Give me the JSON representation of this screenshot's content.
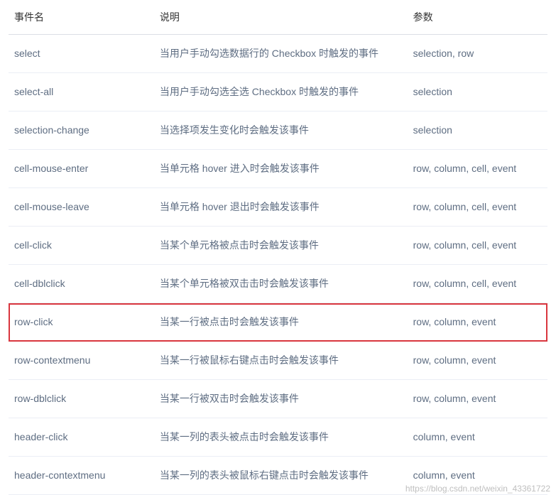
{
  "headers": {
    "name": "事件名",
    "desc": "说明",
    "params": "参数"
  },
  "rows": [
    {
      "name": "select",
      "desc": "当用户手动勾选数据行的 Checkbox 时触发的事件",
      "params": "selection, row",
      "highlighted": false
    },
    {
      "name": "select-all",
      "desc": "当用户手动勾选全选 Checkbox 时触发的事件",
      "params": "selection",
      "highlighted": false
    },
    {
      "name": "selection-change",
      "desc": "当选择项发生变化时会触发该事件",
      "params": "selection",
      "highlighted": false
    },
    {
      "name": "cell-mouse-enter",
      "desc": "当单元格 hover 进入时会触发该事件",
      "params": "row, column, cell, event",
      "highlighted": false
    },
    {
      "name": "cell-mouse-leave",
      "desc": "当单元格 hover 退出时会触发该事件",
      "params": "row, column, cell, event",
      "highlighted": false
    },
    {
      "name": "cell-click",
      "desc": "当某个单元格被点击时会触发该事件",
      "params": "row, column, cell, event",
      "highlighted": false
    },
    {
      "name": "cell-dblclick",
      "desc": "当某个单元格被双击击时会触发该事件",
      "params": "row, column, cell, event",
      "highlighted": false
    },
    {
      "name": "row-click",
      "desc": "当某一行被点击时会触发该事件",
      "params": "row, column, event",
      "highlighted": true
    },
    {
      "name": "row-contextmenu",
      "desc": "当某一行被鼠标右键点击时会触发该事件",
      "params": "row, column, event",
      "highlighted": false
    },
    {
      "name": "row-dblclick",
      "desc": "当某一行被双击时会触发该事件",
      "params": "row, column, event",
      "highlighted": false
    },
    {
      "name": "header-click",
      "desc": "当某一列的表头被点击时会触发该事件",
      "params": "column, event",
      "highlighted": false
    },
    {
      "name": "header-contextmenu",
      "desc": "当某一列的表头被鼠标右键点击时会触发该事件",
      "params": "column, event",
      "highlighted": false
    }
  ],
  "watermark": "https://blog.csdn.net/weixin_43361722"
}
